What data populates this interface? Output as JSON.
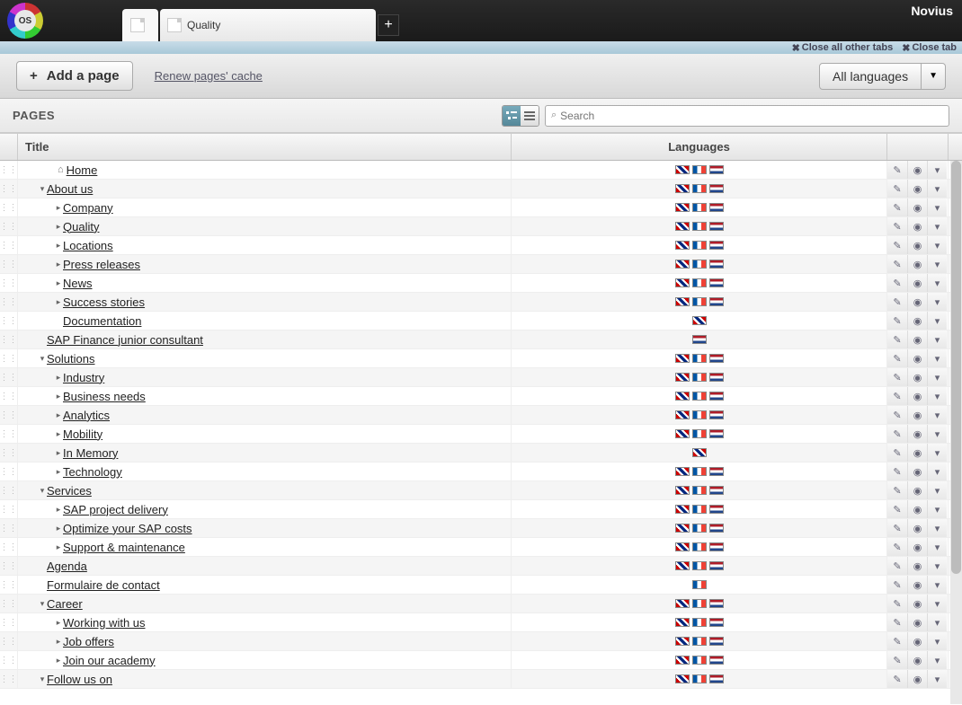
{
  "brand": "Novius",
  "os_logo_text": "OS",
  "tab": {
    "label": "Quality"
  },
  "subbar": {
    "close_all": "Close all other tabs",
    "close_tab": "Close tab"
  },
  "toolbar": {
    "add_page": "Add a page",
    "renew_cache": "Renew pages' cache",
    "lang_selector": "All languages"
  },
  "pages_heading": "PAGES",
  "search_placeholder": "Search",
  "columns": {
    "title": "Title",
    "languages": "Languages"
  },
  "rows": [
    {
      "level": 0,
      "toggle": "",
      "home": true,
      "title": "Home",
      "flags": [
        "en",
        "fr",
        "nl"
      ]
    },
    {
      "level": 0,
      "toggle": "down",
      "title": "About us",
      "flags": [
        "en",
        "fr",
        "nl"
      ]
    },
    {
      "level": 1,
      "toggle": "right",
      "title": "Company",
      "flags": [
        "en",
        "fr",
        "nl"
      ]
    },
    {
      "level": 1,
      "toggle": "right",
      "title": "Quality",
      "flags": [
        "en",
        "fr",
        "nl"
      ]
    },
    {
      "level": 1,
      "toggle": "right",
      "title": "Locations",
      "flags": [
        "en",
        "fr",
        "nl"
      ]
    },
    {
      "level": 1,
      "toggle": "right",
      "title": "Press releases",
      "flags": [
        "en",
        "fr",
        "nl"
      ]
    },
    {
      "level": 1,
      "toggle": "right",
      "title": "News",
      "flags": [
        "en",
        "fr",
        "nl"
      ]
    },
    {
      "level": 1,
      "toggle": "right",
      "title": "Success stories",
      "flags": [
        "en",
        "fr",
        "nl"
      ]
    },
    {
      "level": 1,
      "toggle": "",
      "title": "Documentation",
      "flags": [
        "en"
      ]
    },
    {
      "level": 0,
      "toggle": "",
      "title": "SAP Finance junior consultant",
      "flags": [
        "nl"
      ]
    },
    {
      "level": 0,
      "toggle": "down",
      "title": "Solutions",
      "flags": [
        "en",
        "fr",
        "nl"
      ]
    },
    {
      "level": 1,
      "toggle": "right",
      "title": "Industry",
      "flags": [
        "en",
        "fr",
        "nl"
      ]
    },
    {
      "level": 1,
      "toggle": "right",
      "title": "Business needs",
      "flags": [
        "en",
        "fr",
        "nl"
      ]
    },
    {
      "level": 1,
      "toggle": "right",
      "title": "Analytics",
      "flags": [
        "en",
        "fr",
        "nl"
      ]
    },
    {
      "level": 1,
      "toggle": "right",
      "title": "Mobility",
      "flags": [
        "en",
        "fr",
        "nl"
      ]
    },
    {
      "level": 1,
      "toggle": "right",
      "title": "In Memory",
      "flags": [
        "en"
      ]
    },
    {
      "level": 1,
      "toggle": "right",
      "title": "Technology",
      "flags": [
        "en",
        "fr",
        "nl"
      ]
    },
    {
      "level": 0,
      "toggle": "down",
      "title": "Services",
      "flags": [
        "en",
        "fr",
        "nl"
      ]
    },
    {
      "level": 1,
      "toggle": "right",
      "title": "SAP project delivery",
      "flags": [
        "en",
        "fr",
        "nl"
      ]
    },
    {
      "level": 1,
      "toggle": "right",
      "title": "Optimize your SAP costs",
      "flags": [
        "en",
        "fr",
        "nl"
      ]
    },
    {
      "level": 1,
      "toggle": "right",
      "title": "Support & maintenance",
      "flags": [
        "en",
        "fr",
        "nl"
      ]
    },
    {
      "level": 0,
      "toggle": "",
      "title": "Agenda",
      "flags": [
        "en",
        "fr",
        "nl"
      ]
    },
    {
      "level": 0,
      "toggle": "",
      "title": "Formulaire de contact",
      "flags": [
        "fr"
      ]
    },
    {
      "level": 0,
      "toggle": "down",
      "title": "Career",
      "flags": [
        "en",
        "fr",
        "nl"
      ]
    },
    {
      "level": 1,
      "toggle": "right",
      "title": "Working with us",
      "flags": [
        "en",
        "fr",
        "nl"
      ]
    },
    {
      "level": 1,
      "toggle": "right",
      "title": "Job offers",
      "flags": [
        "en",
        "fr",
        "nl"
      ]
    },
    {
      "level": 1,
      "toggle": "right",
      "title": "Join our academy",
      "flags": [
        "en",
        "fr",
        "nl"
      ]
    },
    {
      "level": 0,
      "toggle": "down",
      "title": "Follow us on",
      "flags": [
        "en",
        "fr",
        "nl"
      ]
    }
  ]
}
